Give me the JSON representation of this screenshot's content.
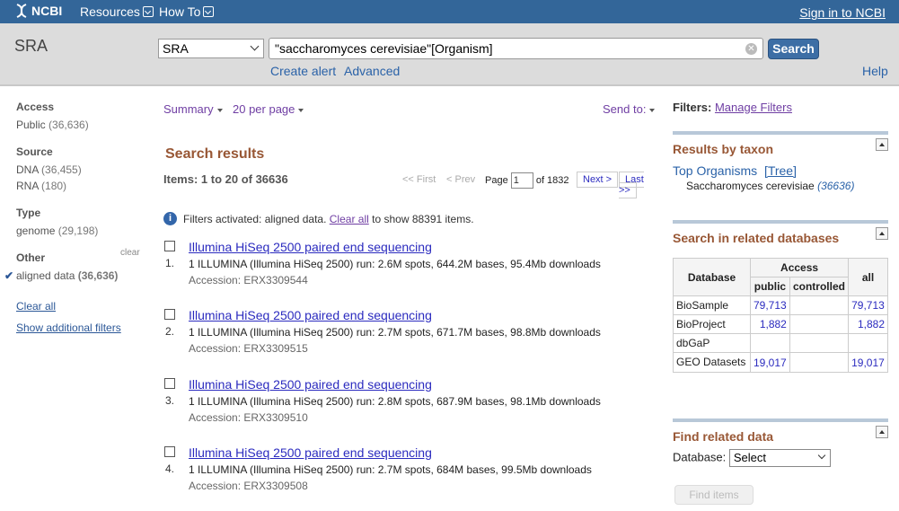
{
  "topbar": {
    "logo": "NCBI",
    "resources": "Resources",
    "howto": "How To",
    "signin": "Sign in to NCBI"
  },
  "search": {
    "db_name": "SRA",
    "db_select": "SRA",
    "term": "\"saccharomyces cerevisiae\"[Organism]",
    "button": "Search",
    "create_alert": "Create alert",
    "advanced": "Advanced",
    "help": "Help"
  },
  "filters_left": {
    "access": {
      "title": "Access",
      "items": [
        {
          "label": "Public",
          "count": "(36,636)"
        }
      ]
    },
    "source": {
      "title": "Source",
      "items": [
        {
          "label": "DNA",
          "count": "(36,455)"
        },
        {
          "label": "RNA",
          "count": "(180)"
        }
      ]
    },
    "type": {
      "title": "Type",
      "items": [
        {
          "label": "genome",
          "count": "(29,198)"
        }
      ]
    },
    "other": {
      "title": "Other",
      "clear": "clear",
      "items": [
        {
          "label": "aligned data",
          "count": "(36,636)"
        }
      ]
    },
    "clear_all": "Clear all",
    "show_additional": "Show additional filters"
  },
  "controls": {
    "summary": "Summary",
    "per_page": "20 per page",
    "send_to": "Send to:"
  },
  "results": {
    "title": "Search results",
    "items_text": "Items: 1 to 20 of 36636",
    "pager": {
      "first": "<< First",
      "prev": "< Prev",
      "page_label": "Page",
      "page": "1",
      "of": "of 1832",
      "next": "Next >",
      "last": "Last >>"
    },
    "filters_activated": {
      "prefix": "Filters activated: aligned data.",
      "clear_link": "Clear all",
      "suffix": "to show 88391 items."
    },
    "list": [
      {
        "num": "1.",
        "title": "Illumina HiSeq 2500 paired end sequencing",
        "desc": "1 ILLUMINA (Illumina HiSeq 2500) run: 2.6M spots, 644.2M bases, 95.4Mb downloads",
        "accession": "Accession: ERX3309544"
      },
      {
        "num": "2.",
        "title": "Illumina HiSeq 2500 paired end sequencing",
        "desc": "1 ILLUMINA (Illumina HiSeq 2500) run: 2.7M spots, 671.7M bases, 98.8Mb downloads",
        "accession": "Accession: ERX3309515"
      },
      {
        "num": "3.",
        "title": "Illumina HiSeq 2500 paired end sequencing",
        "desc": "1 ILLUMINA (Illumina HiSeq 2500) run: 2.8M spots, 687.9M bases, 98.1Mb downloads",
        "accession": "Accession: ERX3309510"
      },
      {
        "num": "4.",
        "title": "Illumina HiSeq 2500 paired end sequencing",
        "desc": "1 ILLUMINA (Illumina HiSeq 2500) run: 2.7M spots, 684M bases, 99.5Mb downloads",
        "accession": "Accession: ERX3309508"
      }
    ]
  },
  "right": {
    "filters_label": "Filters:",
    "manage_filters": "Manage Filters",
    "taxon": {
      "title": "Results by taxon",
      "top_organisms": "Top Organisms",
      "tree": "[Tree]",
      "organism": "Saccharomyces cerevisiae",
      "count": "(36636)"
    },
    "related": {
      "title": "Search in related databases",
      "headers": {
        "database": "Database",
        "access": "Access",
        "public": "public",
        "controlled": "controlled",
        "all": "all"
      },
      "rows": [
        {
          "db": "BioSample",
          "public": "79,713",
          "controlled": "",
          "all": "79,713"
        },
        {
          "db": "BioProject",
          "public": "1,882",
          "controlled": "",
          "all": "1,882"
        },
        {
          "db": "dbGaP",
          "public": "",
          "controlled": "",
          "all": ""
        },
        {
          "db": "GEO Datasets",
          "public": "19,017",
          "controlled": "",
          "all": "19,017"
        }
      ]
    },
    "find": {
      "title": "Find related data",
      "db_label": "Database:",
      "select": "Select",
      "button": "Find items"
    }
  },
  "colors": {
    "topbar": "#336699",
    "search_button": "#3d6ea5",
    "heading": "#985735",
    "link": "#2b2bbf"
  }
}
